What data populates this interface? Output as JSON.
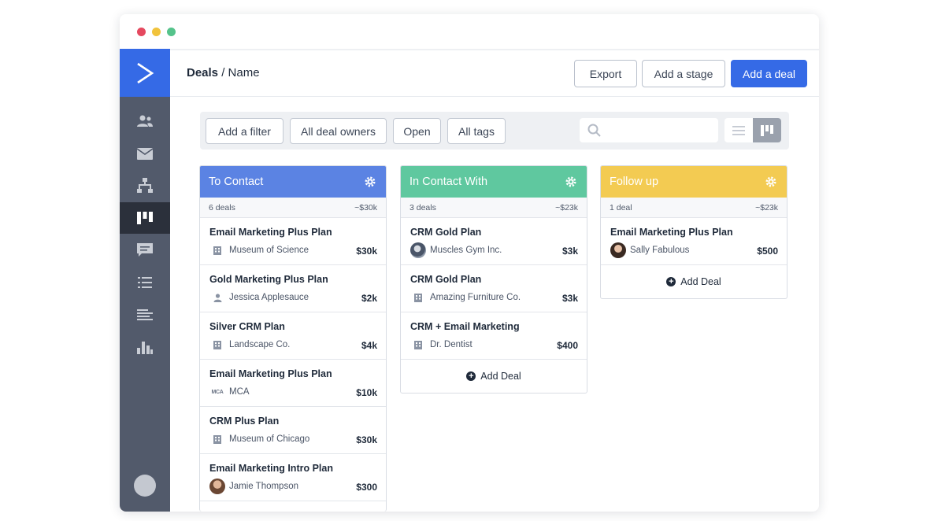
{
  "window": {
    "dots": [
      "#e5495f",
      "#f1c33c",
      "#55c38b"
    ]
  },
  "sidebar": {
    "brand_color": "#356ae6",
    "items": [
      {
        "icon": "contacts-icon"
      },
      {
        "icon": "mail-icon"
      },
      {
        "icon": "automations-icon"
      },
      {
        "icon": "deals-board-icon",
        "active": true
      },
      {
        "icon": "chat-icon"
      },
      {
        "icon": "lists-icon"
      },
      {
        "icon": "reports-text-icon"
      },
      {
        "icon": "bar-chart-icon"
      }
    ]
  },
  "header": {
    "breadcrumb_section": "Deals",
    "breadcrumb_separator": " / ",
    "breadcrumb_page": "Name",
    "export_label": "Export",
    "add_stage_label": "Add a stage",
    "add_deal_label": "Add a deal"
  },
  "filters": {
    "add_filter": "Add a filter",
    "owners": "All deal owners",
    "status": "Open",
    "tags": "All tags",
    "search_placeholder": ""
  },
  "columns": [
    {
      "title": "To Contact",
      "color": "#5b83e3",
      "count": "6 deals",
      "total": "~$30k",
      "cards": [
        {
          "title": "Email Marketing Plus Plan",
          "org": "Museum of Science",
          "value": "$30k",
          "icon": "building-icon"
        },
        {
          "title": "Gold Marketing Plus Plan",
          "org": "Jessica Applesauce",
          "value": "$2k",
          "icon": "person-icon"
        },
        {
          "title": "Silver CRM Plan",
          "org": "Landscape Co.",
          "value": "$4k",
          "icon": "building-icon"
        },
        {
          "title": "Email Marketing Plus Plan",
          "org": "MCA",
          "value": "$10k",
          "icon": "mca-logo-icon",
          "logo_text": "MCA"
        },
        {
          "title": "CRM Plus Plan",
          "org": "Museum of Chicago",
          "value": "$30k",
          "icon": "building-icon"
        },
        {
          "title": "Email Marketing Intro Plan",
          "org": "Jamie Thompson",
          "value": "$300",
          "icon": "avatar-photo-icon"
        }
      ]
    },
    {
      "title": "In Contact With",
      "color": "#5fc89f",
      "count": "3 deals",
      "total": "~$23k",
      "add_label": "Add Deal",
      "cards": [
        {
          "title": "CRM Gold Plan",
          "org": "Muscles Gym Inc.",
          "value": "$3k",
          "icon": "avatar-photo-icon"
        },
        {
          "title": "CRM Gold Plan",
          "org": "Amazing Furniture Co.",
          "value": "$3k",
          "icon": "building-icon"
        },
        {
          "title": "CRM + Email Marketing",
          "org": "Dr. Dentist",
          "value": "$400",
          "icon": "building-icon"
        }
      ]
    },
    {
      "title": "Follow up",
      "color": "#f3cb52",
      "count": "1 deal",
      "total": "~$23k",
      "add_label": "Add Deal",
      "cards": [
        {
          "title": "Email Marketing Plus Plan",
          "org": "Sally Fabulous",
          "value": "$500",
          "icon": "avatar-photo-icon"
        }
      ]
    }
  ]
}
